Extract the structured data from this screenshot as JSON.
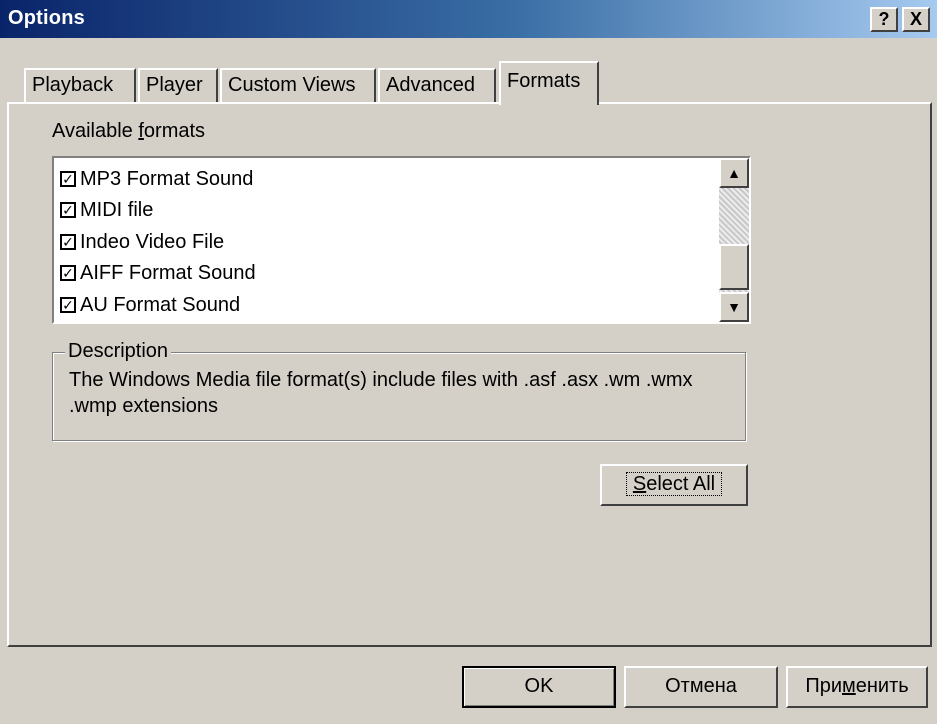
{
  "window": {
    "title": "Options",
    "help_label": "?",
    "close_label": "X"
  },
  "tabs": [
    {
      "label": "Playback"
    },
    {
      "label": "Player"
    },
    {
      "label": "Custom Views"
    },
    {
      "label": "Advanced"
    },
    {
      "label": "Formats",
      "selected": true
    }
  ],
  "formats": {
    "label_prefix": "Available ",
    "label_access_key": "f",
    "label_suffix": "ormats",
    "items": [
      {
        "label": "MP3 Format Sound",
        "checked": true
      },
      {
        "label": "MIDI file",
        "checked": true
      },
      {
        "label": "Indeo Video File",
        "checked": true
      },
      {
        "label": "AIFF Format Sound",
        "checked": true
      },
      {
        "label": "AU Format Sound",
        "checked": true
      }
    ],
    "scroll_up_icon": "▲",
    "scroll_down_icon": "▼"
  },
  "description": {
    "title": "Description",
    "text": "The Windows Media file format(s) include files with .asf .asx .wm .wmx .wmp extensions"
  },
  "buttons": {
    "select_all_access_key": "S",
    "select_all_rest": "elect All",
    "ok": "OK",
    "cancel": "Отмена",
    "apply_prefix": "При",
    "apply_access_key": "м",
    "apply_suffix": "енить"
  }
}
